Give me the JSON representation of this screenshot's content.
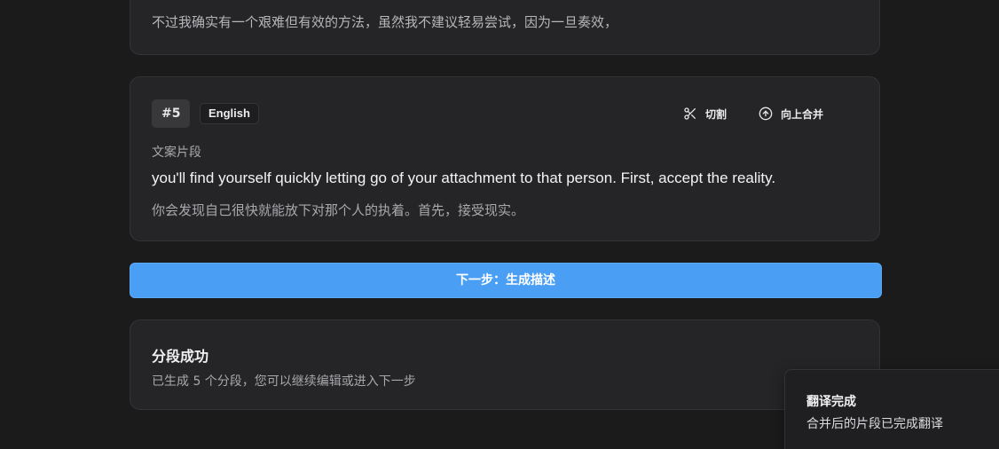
{
  "previous_segment": {
    "text": "不过我确实有一个艰难但有效的方法，虽然我不建议轻易尝试，因为一旦奏效，"
  },
  "segment": {
    "index": "#5",
    "language": "English",
    "actions": {
      "cut_label": "切割",
      "cut_icon": "scissors-icon",
      "merge_up_label": "向上合并",
      "merge_up_icon": "arrow-up-circle-icon"
    },
    "field_label": "文案片段",
    "original_text": "you'll find yourself quickly letting go of your attachment to that person. First, accept the reality.",
    "translated_text": "你会发现自己很快就能放下对那个人的执着。首先，接受现实。"
  },
  "next_step_button": {
    "label": "下一步：生成描述",
    "color": "#4a9ff5"
  },
  "success_card": {
    "title": "分段成功",
    "description": "已生成 5 个分段，您可以继续编辑或进入下一步"
  },
  "toast": {
    "title": "翻译完成",
    "message": "合并后的片段已完成翻译"
  }
}
